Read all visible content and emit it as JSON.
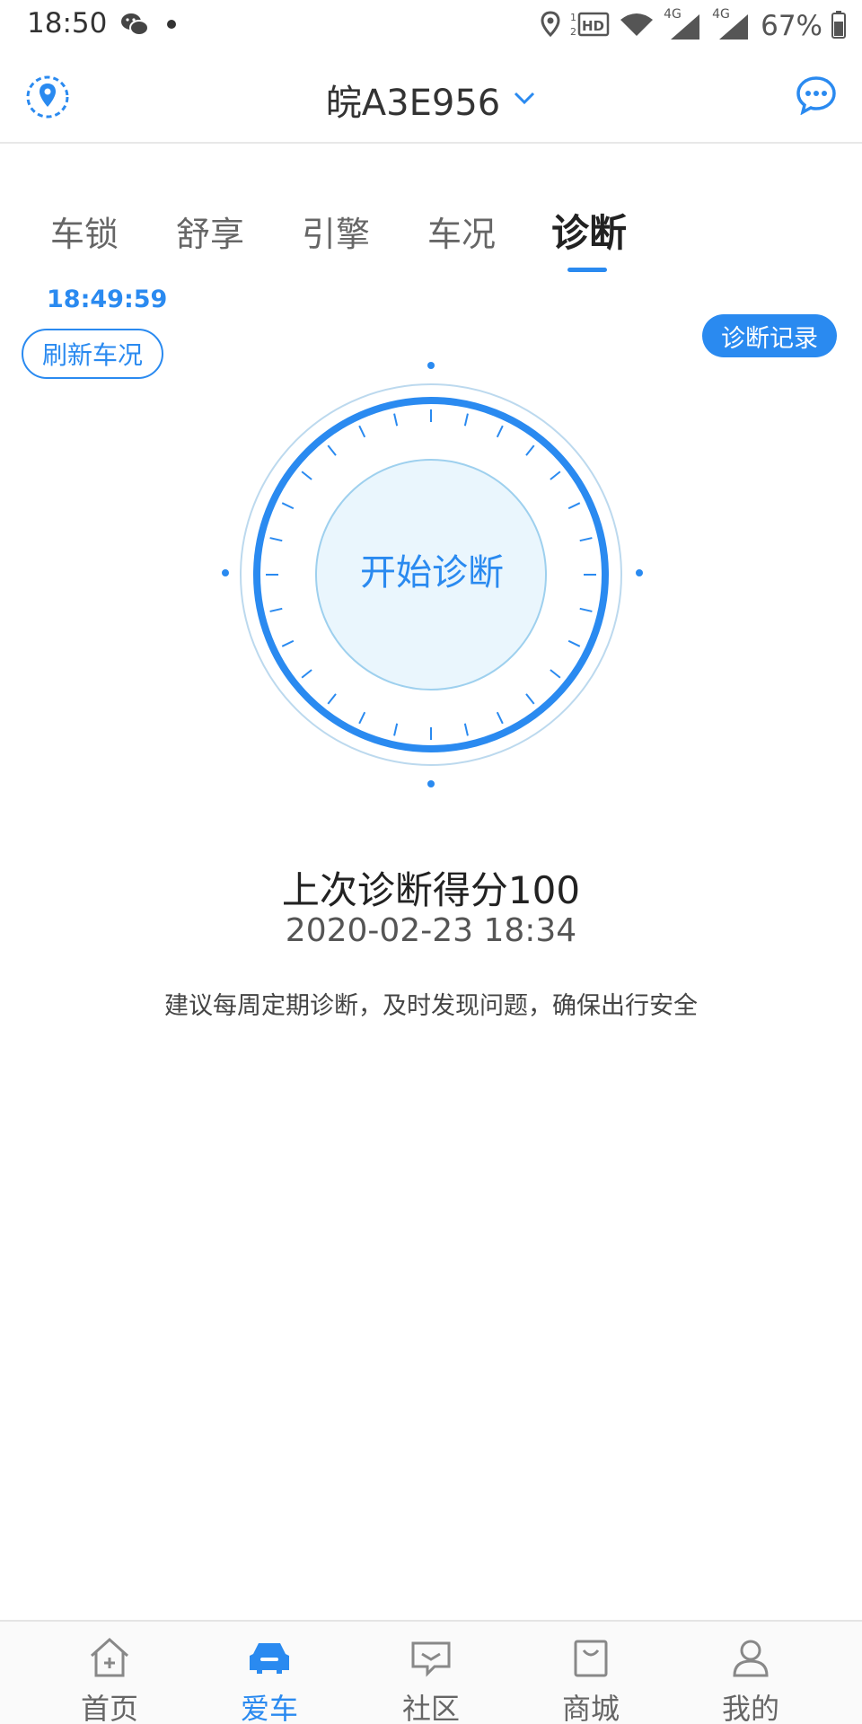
{
  "status_bar": {
    "time": "18:50",
    "battery": "67%",
    "icons": [
      "wechat-icon",
      "location-icon",
      "hd-icon",
      "wifi-icon",
      "signal-4g-icon",
      "signal-4g-icon",
      "battery-icon"
    ],
    "network_1": "4G",
    "network_2": "4G"
  },
  "header": {
    "title": "皖A3E956",
    "left_icon": "location-pin-icon",
    "right_icon": "chat-bubble-icon"
  },
  "tabs": [
    {
      "label": "车锁",
      "active": false
    },
    {
      "label": "舒享",
      "active": false
    },
    {
      "label": "引擎",
      "active": false
    },
    {
      "label": "车况",
      "active": false
    },
    {
      "label": "诊断",
      "active": true
    }
  ],
  "refresh": {
    "time": "18:49:59",
    "button_label": "刷新车况"
  },
  "records_button_label": "诊断记录",
  "dial": {
    "label": "开始诊断"
  },
  "score": {
    "text": "上次诊断得分100",
    "date": "2020-02-23 18:34"
  },
  "advice": "建议每周定期诊断，及时发现问题，确保出行安全",
  "bottom_nav": [
    {
      "label": "首页",
      "icon": "home-icon",
      "active": false
    },
    {
      "label": "爱车",
      "icon": "car-icon",
      "active": true
    },
    {
      "label": "社区",
      "icon": "community-icon",
      "active": false
    },
    {
      "label": "商城",
      "icon": "shop-bag-icon",
      "active": false
    },
    {
      "label": "我的",
      "icon": "profile-icon",
      "active": false
    }
  ],
  "colors": {
    "accent": "#2a8af0",
    "dial_fill": "#eaf6fd",
    "text_dark": "#222222",
    "text_muted": "#666666"
  }
}
